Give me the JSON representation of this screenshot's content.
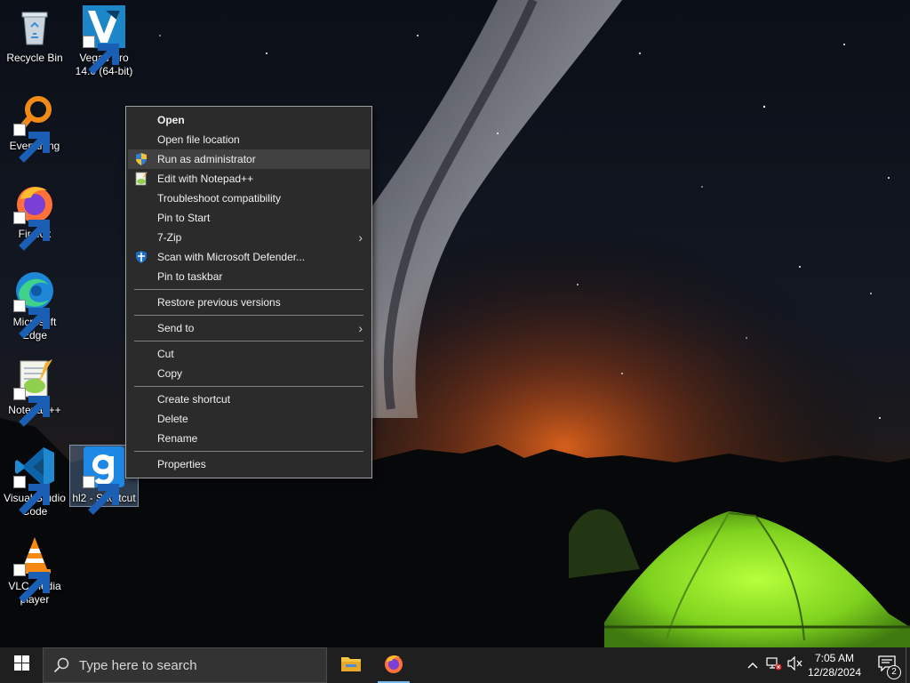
{
  "desktop": {
    "icons": [
      {
        "label": "Recycle Bin"
      },
      {
        "label": "Vegas Pro 14.0 (64-bit)"
      },
      {
        "label": "Everything"
      },
      {
        "label": "Firefox"
      },
      {
        "label": "Microsoft Edge"
      },
      {
        "label": "Notepad++"
      },
      {
        "label": "Visual Studio Code"
      },
      {
        "label": "hl2 - Shortcut"
      },
      {
        "label": "VLC media player"
      }
    ]
  },
  "context_menu": {
    "items": [
      {
        "label": "Open"
      },
      {
        "label": "Open file location"
      },
      {
        "label": "Run as administrator"
      },
      {
        "label": "Edit with Notepad++"
      },
      {
        "label": "Troubleshoot compatibility"
      },
      {
        "label": "Pin to Start"
      },
      {
        "label": "7-Zip"
      },
      {
        "label": "Scan with Microsoft Defender..."
      },
      {
        "label": "Pin to taskbar"
      },
      {
        "label": "Restore previous versions"
      },
      {
        "label": "Send to"
      },
      {
        "label": "Cut"
      },
      {
        "label": "Copy"
      },
      {
        "label": "Create shortcut"
      },
      {
        "label": "Delete"
      },
      {
        "label": "Rename"
      },
      {
        "label": "Properties"
      }
    ],
    "submenu_arrow": "›"
  },
  "taskbar": {
    "search_placeholder": "Type here to search",
    "time": "7:05 AM",
    "date": "12/28/2024",
    "notification_count": "2"
  },
  "colors": {
    "menu_bg": "#2b2b2b",
    "menu_hover": "#414141",
    "taskbar_bg": "#1f1f1f",
    "accent": "#76b9ed"
  }
}
